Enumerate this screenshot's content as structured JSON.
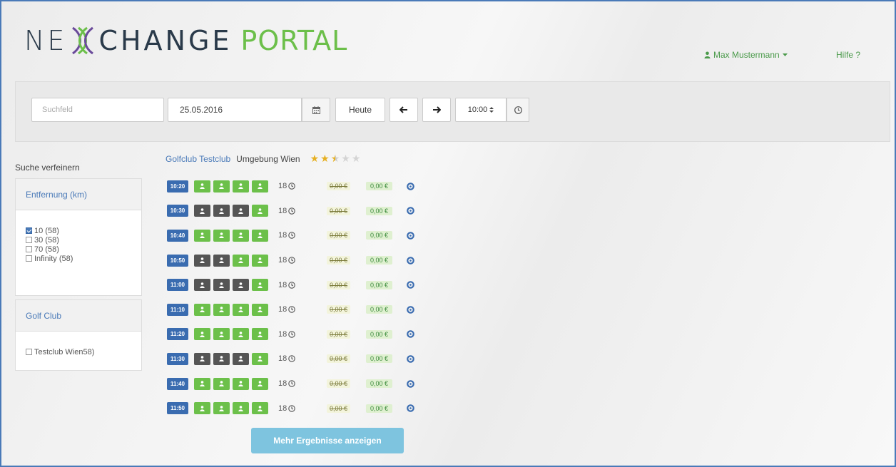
{
  "header": {
    "logo_ne": "NE",
    "logo_change": "CHANGE",
    "logo_portal": "PORTAL",
    "user_name": "Max Mustermann",
    "help_label": "Hilfe ?"
  },
  "searchbar": {
    "search_placeholder": "Suchfeld",
    "date_value": "25.05.2016",
    "today_label": "Heute",
    "time_value": "10:00"
  },
  "sidebar": {
    "refine_label": "Suche verfeinern",
    "distance_title": "Entfernung (km)",
    "distance_options": [
      {
        "label": "10 (58)",
        "checked": true
      },
      {
        "label": "30 (58)",
        "checked": false
      },
      {
        "label": "70 (58)",
        "checked": false
      },
      {
        "label": "Infinity (58)",
        "checked": false
      }
    ],
    "club_title": "Golf Club",
    "club_options": [
      {
        "label": "Testclub Wien58)",
        "checked": false
      }
    ]
  },
  "club": {
    "name": "Golfclub Testclub",
    "region": "Umgebung Wien",
    "rating": 2.5,
    "rating_max": 5
  },
  "colors": {
    "accent": "#4a7ab8",
    "free": "#6cc04a",
    "taken": "#555555",
    "time_badge": "#3a6cb0",
    "more_button": "#7ec4df"
  },
  "teetimes": [
    {
      "time": "10:20",
      "slots": [
        "free",
        "free",
        "free",
        "free"
      ],
      "holes": "18",
      "price_old": "0,00 €",
      "price": "0,00 €"
    },
    {
      "time": "10:30",
      "slots": [
        "taken",
        "taken",
        "taken",
        "free"
      ],
      "holes": "18",
      "price_old": "0,00 €",
      "price": "0,00 €"
    },
    {
      "time": "10:40",
      "slots": [
        "free",
        "free",
        "free",
        "free"
      ],
      "holes": "18",
      "price_old": "0,00 €",
      "price": "0,00 €"
    },
    {
      "time": "10:50",
      "slots": [
        "taken",
        "taken",
        "free",
        "free"
      ],
      "holes": "18",
      "price_old": "0,00 €",
      "price": "0,00 €"
    },
    {
      "time": "11:00",
      "slots": [
        "taken",
        "taken",
        "taken",
        "free"
      ],
      "holes": "18",
      "price_old": "0,00 €",
      "price": "0,00 €"
    },
    {
      "time": "11:10",
      "slots": [
        "free",
        "free",
        "free",
        "free"
      ],
      "holes": "18",
      "price_old": "0,00 €",
      "price": "0,00 €"
    },
    {
      "time": "11:20",
      "slots": [
        "free",
        "free",
        "free",
        "free"
      ],
      "holes": "18",
      "price_old": "0,00 €",
      "price": "0,00 €"
    },
    {
      "time": "11:30",
      "slots": [
        "taken",
        "taken",
        "taken",
        "free"
      ],
      "holes": "18",
      "price_old": "0,00 €",
      "price": "0,00 €"
    },
    {
      "time": "11:40",
      "slots": [
        "free",
        "free",
        "free",
        "free"
      ],
      "holes": "18",
      "price_old": "0,00 €",
      "price": "0,00 €"
    },
    {
      "time": "11:50",
      "slots": [
        "free",
        "free",
        "free",
        "free"
      ],
      "holes": "18",
      "price_old": "0,00 €",
      "price": "0,00 €"
    }
  ],
  "more_label": "Mehr Ergebnisse anzeigen"
}
